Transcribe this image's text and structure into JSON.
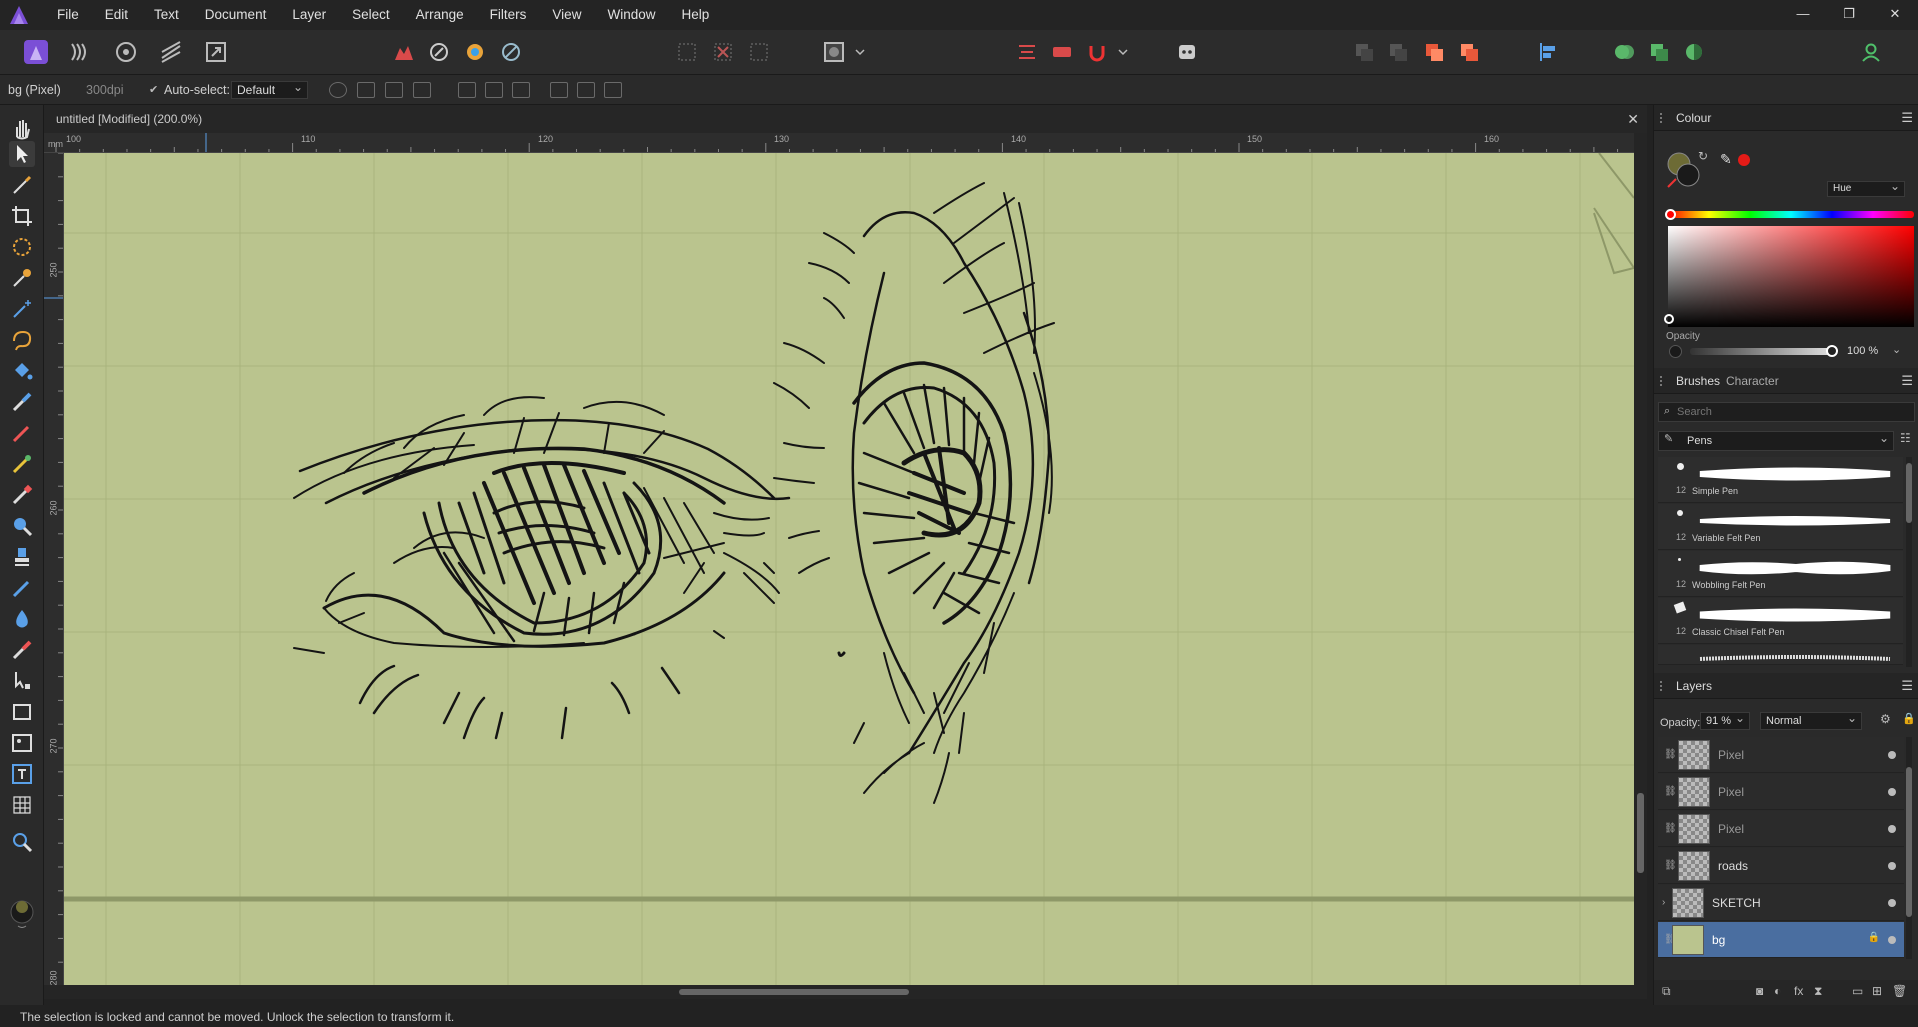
{
  "menu": {
    "items": [
      "File",
      "Edit",
      "Text",
      "Document",
      "Layer",
      "Select",
      "Arrange",
      "Filters",
      "View",
      "Window",
      "Help"
    ],
    "window_controls": [
      "—",
      "❐",
      "✕"
    ]
  },
  "context": {
    "layer_info": "bg (Pixel)",
    "dpi": "300dpi",
    "autoselect_label": "Auto-select:",
    "autoselect_value": "Default"
  },
  "document": {
    "tab_title": "untitled [Modified] (200.0%)",
    "close": "✕",
    "ruler_unit": "mm",
    "ruler_h": [
      "100",
      "110",
      "120",
      "130",
      "140",
      "150",
      "160"
    ],
    "ruler_v": [
      "250",
      "260",
      "270",
      "280"
    ]
  },
  "colour_panel": {
    "title": "Colour",
    "mode": "Hue",
    "opacity_label": "Opacity",
    "opacity_value": "100 %",
    "fill_color": "#6d6b35",
    "stroke_color": "#1a1a1a",
    "swatch_red": "#e41b17"
  },
  "brushes_panel": {
    "tab_brushes": "Brushes",
    "tab_character": "Character",
    "search_placeholder": "Search",
    "category": "Pens",
    "items": [
      {
        "size": "12",
        "name": "Simple Pen"
      },
      {
        "size": "12",
        "name": "Variable Felt Pen"
      },
      {
        "size": "12",
        "name": "Wobbling Felt Pen"
      },
      {
        "size": "12",
        "name": "Classic Chisel Felt Pen"
      }
    ]
  },
  "layers_panel": {
    "title": "Layers",
    "opacity_label": "Opacity:",
    "opacity_value": "91 %",
    "blend_mode": "Normal",
    "layers": [
      {
        "name": "Pixel"
      },
      {
        "name": "Pixel"
      },
      {
        "name": "Pixel"
      },
      {
        "name": "roads"
      },
      {
        "name": "SKETCH"
      },
      {
        "name": "bg"
      }
    ]
  },
  "status": {
    "message": "The selection is locked and cannot be moved. Unlock the selection to transform it."
  }
}
